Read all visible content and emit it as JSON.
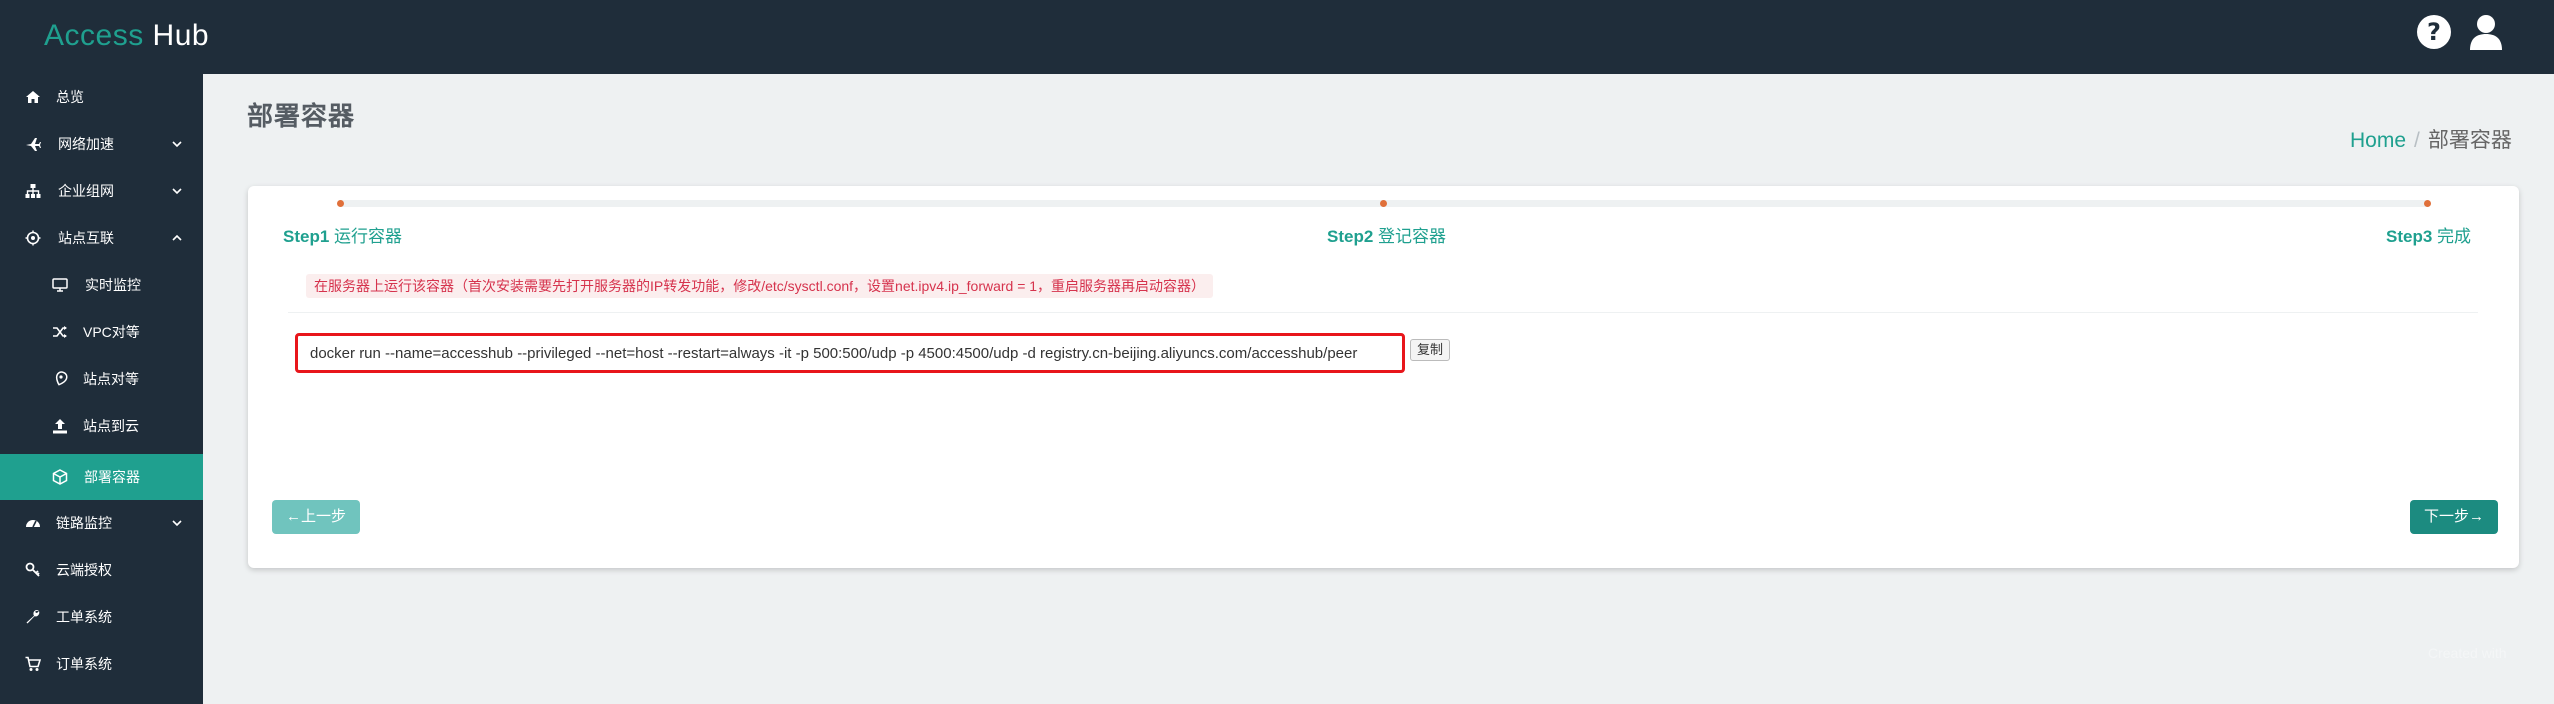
{
  "app": {
    "brand_part1": "Access",
    "brand_part2": "Hub",
    "help_icon": "help-circle-icon",
    "user_icon": "user-icon"
  },
  "sidebar": {
    "items": [
      {
        "label": "总览",
        "icon": "home-icon"
      },
      {
        "label": "网络加速",
        "icon": "plane-icon",
        "expanded": false
      },
      {
        "label": "企业组网",
        "icon": "sitemap-icon",
        "expanded": false
      },
      {
        "label": "站点互联",
        "icon": "link-icon",
        "expanded": true
      },
      {
        "label": "实时监控",
        "icon": "monitor-icon"
      },
      {
        "label": "VPC对等",
        "icon": "shuffle-icon"
      },
      {
        "label": "站点对等",
        "icon": "location-icon"
      },
      {
        "label": "站点到云",
        "icon": "upload-icon"
      },
      {
        "label": "部署容器",
        "icon": "cube-icon",
        "active": true
      },
      {
        "label": "链路监控",
        "icon": "dashboard-icon",
        "expanded": false
      },
      {
        "label": "云端授权",
        "icon": "key-icon"
      },
      {
        "label": "工单系统",
        "icon": "wrench-icon"
      },
      {
        "label": "订单系统",
        "icon": "cart-icon"
      }
    ]
  },
  "page": {
    "title": "部署容器",
    "breadcrumb": {
      "home": "Home",
      "separator": "/",
      "current": "部署容器"
    }
  },
  "wizard": {
    "steps": [
      {
        "num": "Step1",
        "name": "运行容器"
      },
      {
        "num": "Step2",
        "name": "登记容器"
      },
      {
        "num": "Step3",
        "name": "完成"
      }
    ],
    "notice": "在服务器上运行该容器（首次安装需要先打开服务器的IP转发功能，修改/etc/sysctl.conf，设置net.ipv4.ip_forward = 1，重启服务器再启动容器）",
    "command": "docker run --name=accesshub --privileged --net=host --restart=always -it -p 500:500/udp -p 4500:4500/udp -d registry.cn-beijing.aliyuncs.com/accesshub/peer",
    "copy_label": "复制",
    "prev_label": "←上一步",
    "next_label": "下一步→"
  },
  "footer": {
    "note": "Created with"
  },
  "colors": {
    "sidebar_bg": "#1f2d3a",
    "accent": "#1fa08f",
    "highlight_border": "#e8161b",
    "notice_text": "#d6334d"
  }
}
